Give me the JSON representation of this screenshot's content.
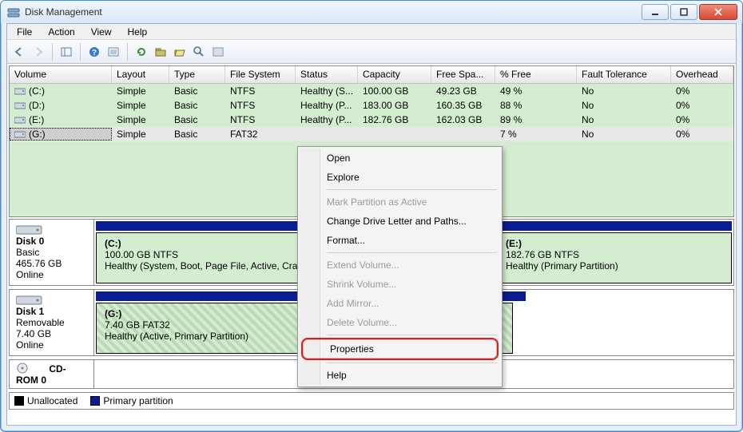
{
  "window": {
    "title": "Disk Management"
  },
  "menu": [
    "File",
    "Action",
    "View",
    "Help"
  ],
  "headers": {
    "volume": "Volume",
    "layout": "Layout",
    "type": "Type",
    "fs": "File System",
    "status": "Status",
    "capacity": "Capacity",
    "free": "Free Spa...",
    "pct": "% Free",
    "fault": "Fault Tolerance",
    "overhead": "Overhead"
  },
  "rows": [
    {
      "vol": "(C:)",
      "layout": "Simple",
      "type": "Basic",
      "fs": "NTFS",
      "status": "Healthy (S...",
      "cap": "100.00 GB",
      "free": "49.23 GB",
      "pct": "49 %",
      "fault": "No",
      "over": "0%"
    },
    {
      "vol": "(D:)",
      "layout": "Simple",
      "type": "Basic",
      "fs": "NTFS",
      "status": "Healthy (P...",
      "cap": "183.00 GB",
      "free": "160.35 GB",
      "pct": "88 %",
      "fault": "No",
      "over": "0%"
    },
    {
      "vol": "(E:)",
      "layout": "Simple",
      "type": "Basic",
      "fs": "NTFS",
      "status": "Healthy (P...",
      "cap": "182.76 GB",
      "free": "162.03 GB",
      "pct": "89 %",
      "fault": "No",
      "over": "0%"
    },
    {
      "vol": "(G:)",
      "layout": "Simple",
      "type": "Basic",
      "fs": "FAT32",
      "status": "",
      "cap": "",
      "free": "",
      "pct": "7 %",
      "fault": "No",
      "over": "0%",
      "selected": true
    }
  ],
  "disks": {
    "d0": {
      "name": "Disk 0",
      "type": "Basic",
      "size": "465.76 GB",
      "state": "Online",
      "vols": [
        {
          "name": "(C:)",
          "line2": "100.00 GB NTFS",
          "line3": "Healthy (System, Boot, Page File, Active, Cra"
        },
        {
          "name": "(E:)",
          "line2": "182.76 GB NTFS",
          "line3": "Healthy (Primary Partition)"
        }
      ]
    },
    "d1": {
      "name": "Disk 1",
      "type": "Removable",
      "size": "7.40 GB",
      "state": "Online",
      "vols": [
        {
          "name": "(G:)",
          "line2": "7.40 GB FAT32",
          "line3": "Healthy (Active, Primary Partition)"
        }
      ]
    },
    "cd": {
      "name": "CD-ROM 0"
    }
  },
  "legend": {
    "unalloc": "Unallocated",
    "primary": "Primary partition"
  },
  "ctx": {
    "open": "Open",
    "explore": "Explore",
    "mark_active": "Mark Partition as Active",
    "change_letter": "Change Drive Letter and Paths...",
    "format": "Format...",
    "extend": "Extend Volume...",
    "shrink": "Shrink Volume...",
    "add_mirror": "Add Mirror...",
    "delete": "Delete Volume...",
    "properties": "Properties",
    "help": "Help"
  }
}
